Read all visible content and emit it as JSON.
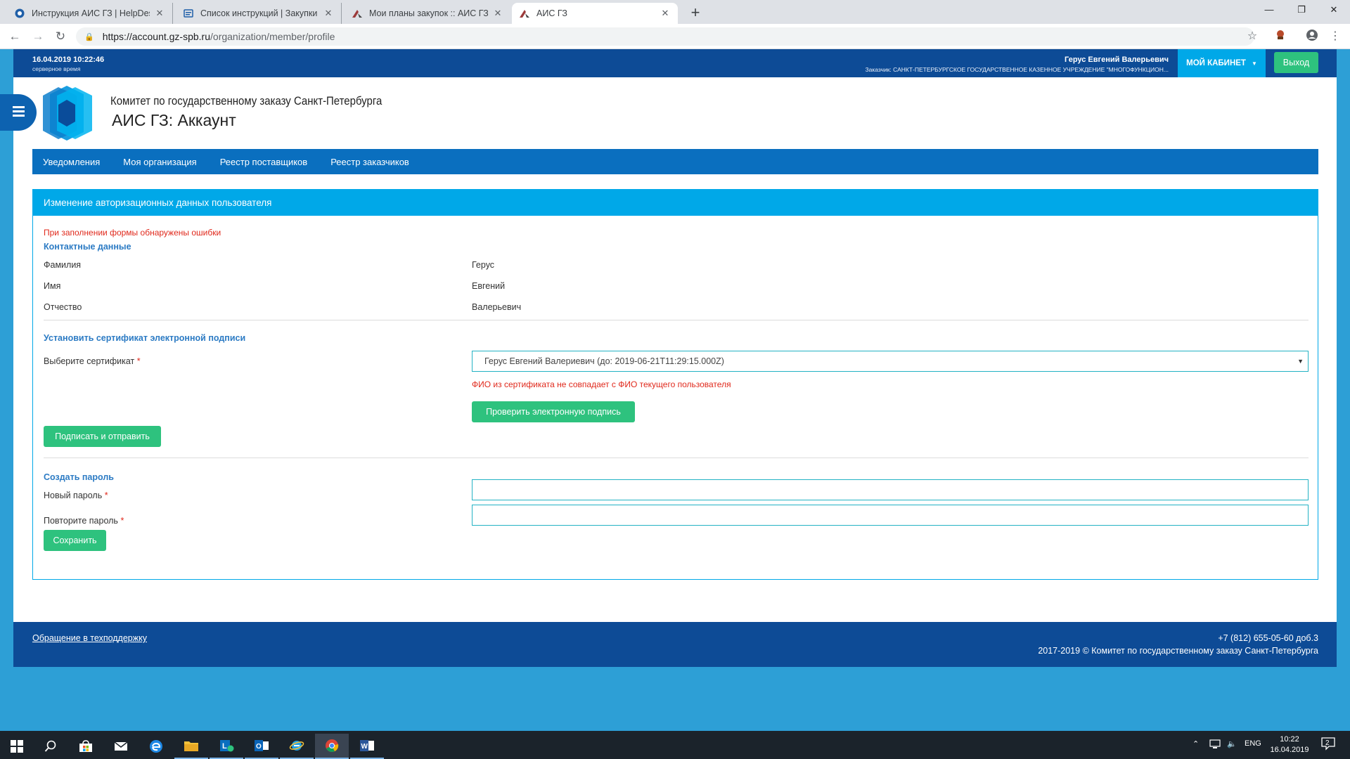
{
  "browser": {
    "tabs": [
      {
        "title": "Инструкция АИС ГЗ | HelpDesk",
        "icon": "helpdesk-icon",
        "active": false
      },
      {
        "title": "Список инструкций | Закупки П",
        "icon": "docs-icon",
        "active": false
      },
      {
        "title": "Мои планы закупок :: АИС ГЗ",
        "icon": "gz-icon",
        "active": false
      },
      {
        "title": "АИС ГЗ",
        "icon": "gz-icon",
        "active": true
      }
    ],
    "url_host": "https://account.gz-spb.ru",
    "url_path": "/organization/member/profile"
  },
  "topbar": {
    "server_time": "16.04.2019 10:22:46",
    "server_time_label": "серверное время",
    "user_name": "Герус Евгений Валерьевич",
    "customer": "Заказчик: САНКТ-ПЕТЕРБУРГСКОЕ ГОСУДАРСТВЕННОЕ КАЗЕННОЕ УЧРЕЖДЕНИЕ \"МНОГОФУНКЦИОН...",
    "cabinet_label": "МОЙ КАБИНЕТ",
    "logout_label": "Выход"
  },
  "header": {
    "org_name": "Комитет по государственному заказу Санкт-Петербурга",
    "app_title": "АИС ГЗ: Аккаунт"
  },
  "nav": {
    "items": [
      "Уведомления",
      "Моя организация",
      "Реестр поставщиков",
      "Реестр заказчиков"
    ]
  },
  "panel": {
    "title": "Изменение авторизационных данных пользователя",
    "form_error": "При заполнении формы обнаружены ошибки",
    "contacts": {
      "heading": "Контактные данные",
      "surname_label": "Фамилия",
      "surname_value": "Герус",
      "name_label": "Имя",
      "name_value": "Евгений",
      "patronymic_label": "Отчество",
      "patronymic_value": "Валерьевич"
    },
    "certificate": {
      "heading": "Установить сертификат электронной подписи",
      "select_label": "Выберите сертификат",
      "selected": "Герус Евгений Валериевич (до: 2019-06-21T11:29:15.000Z)",
      "error": "ФИО из сертификата не совпадает с ФИО текущего пользователя",
      "check_button": "Проверить электронную подпись",
      "sign_button": "Подписать и отправить"
    },
    "password": {
      "heading": "Создать пароль",
      "new_label": "Новый пароль",
      "new_value": "",
      "repeat_label": "Повторите пароль",
      "repeat_value": "",
      "save_button": "Сохранить"
    },
    "required_mark": "*"
  },
  "footer": {
    "support_link": "Обращение в техподдержку",
    "phone": "+7 (812) 655-05-60 доб.3",
    "copyright": "2017-2019 © Комитет по государственному заказу Санкт-Петербурга"
  },
  "taskbar": {
    "lang": "ENG",
    "time": "10:22",
    "date": "16.04.2019",
    "notifications": "2"
  },
  "colors": {
    "topbar": "#0d4b96",
    "accent": "#00a8e8",
    "nav": "#0a6fbf",
    "button_green": "#2ec27e",
    "error": "#e0281b",
    "section_heading": "#2c7bc4",
    "page_background": "#2d9fd6"
  }
}
